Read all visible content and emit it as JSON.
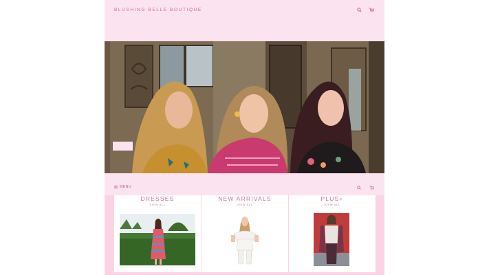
{
  "header": {
    "brand": "BLUSHING BELLE BOUTIQUE",
    "search_icon": "search-icon",
    "cart_icon": "cart-icon"
  },
  "hero": {
    "button_label": "",
    "image": "three women smiling in front of a wooden door"
  },
  "nav": {
    "menu_label": "MENU",
    "menu_icon": "hamburger-icon",
    "search_icon": "search-icon",
    "cart_icon": "cart-icon"
  },
  "categories": [
    {
      "title": "DRESSES",
      "link": "VIEW ALL"
    },
    {
      "title": "NEW ARRIVALS",
      "link": "VIEW ALL"
    },
    {
      "title": "PLUS+",
      "link": "VIEW ALL"
    }
  ],
  "colors": {
    "accent": "#d46a9d",
    "header_bg": "#fbe3ef",
    "section_bg": "#fad4e4"
  }
}
